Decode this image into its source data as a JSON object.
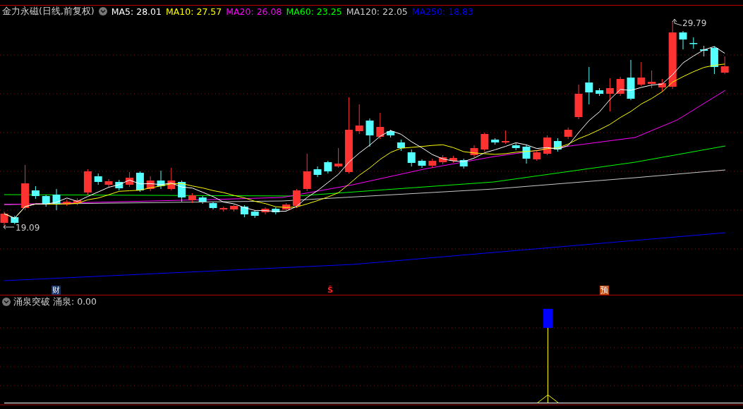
{
  "chart_header": {
    "title": "金力永磁(日线,前复权)",
    "moving_averages": [
      {
        "label": "MA5: 28.01",
        "color": "#ffffff"
      },
      {
        "label": "MA10: 27.57",
        "color": "#ffff00"
      },
      {
        "label": "MA20: 26.08",
        "color": "#ff00ff"
      },
      {
        "label": "MA60: 23.25",
        "color": "#00ff00"
      },
      {
        "label": "MA120: 22.05",
        "color": "#c8c8c8"
      },
      {
        "label": "MA250: 18.83",
        "color": "#0000ff"
      }
    ]
  },
  "price_labels": {
    "high": "29.79",
    "low": "19.09"
  },
  "event_markers": [
    {
      "kind": "finance",
      "text": "财"
    },
    {
      "kind": "signal",
      "text": "Ŝ"
    },
    {
      "kind": "forecast",
      "text": "预"
    }
  ],
  "indicator": {
    "name": "涌泉突破",
    "reading": "涌泉: 0.00"
  }
}
